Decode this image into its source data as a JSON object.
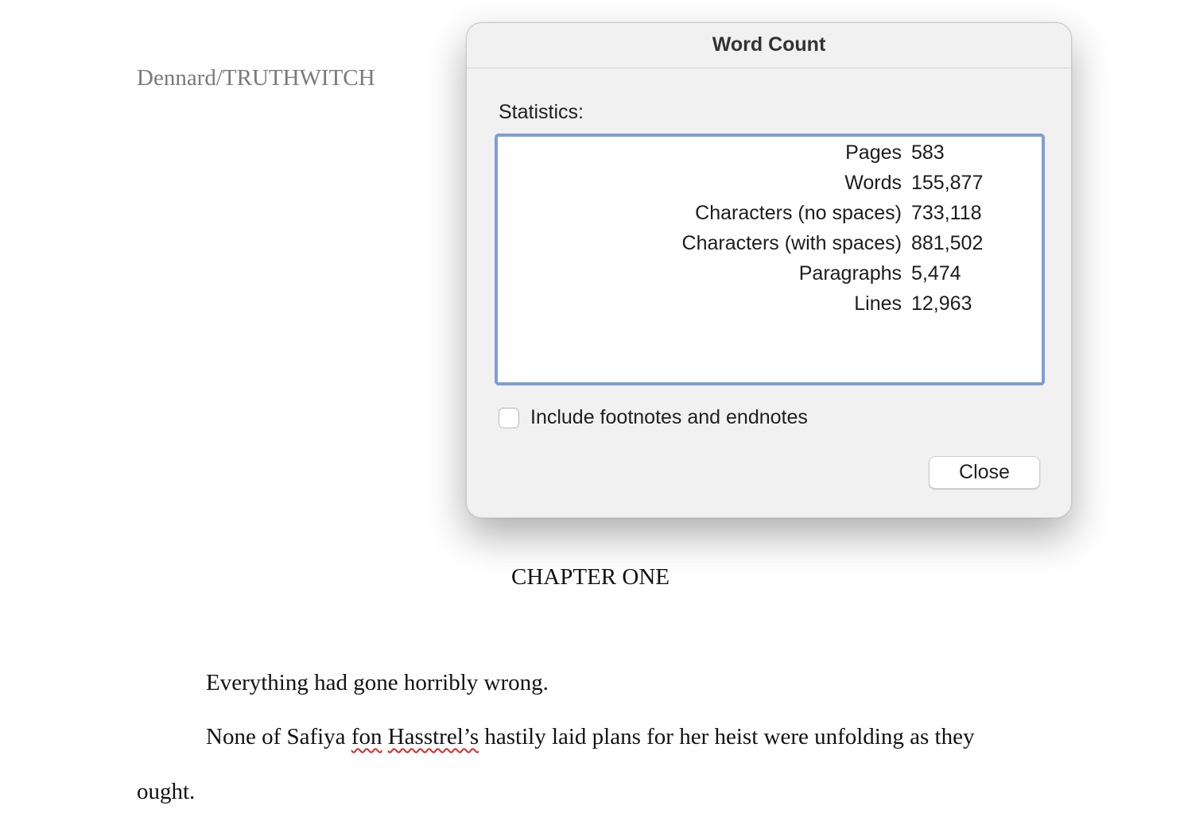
{
  "document": {
    "running_header": "Dennard/TRUTHWITCH",
    "chapter_heading": "CHAPTER ONE",
    "paragraph_1": "Everything had gone horribly wrong.",
    "paragraph_2": {
      "before": "None of Safiya ",
      "misspelled_1": "fon",
      "between": " ",
      "misspelled_2": "Hasstrel’s",
      "after": " hastily laid plans for her heist were unfolding as they"
    },
    "paragraph_3": "ought."
  },
  "dialog": {
    "title": "Word Count",
    "statistics_label": "Statistics:",
    "stats": [
      {
        "label": "Pages",
        "value": "583"
      },
      {
        "label": "Words",
        "value": "155,877"
      },
      {
        "label": "Characters (no spaces)",
        "value": "733,118"
      },
      {
        "label": "Characters (with spaces)",
        "value": "881,502"
      },
      {
        "label": "Paragraphs",
        "value": "5,474"
      },
      {
        "label": "Lines",
        "value": "12,963"
      }
    ],
    "include_footnotes_label": "Include footnotes and endnotes",
    "include_footnotes_checked": false,
    "close_label": "Close",
    "colors": {
      "stats_box_border": "#7f9ed4",
      "dialog_background": "#f1f1f1",
      "spellcheck_underline": "#d92b2b"
    }
  }
}
